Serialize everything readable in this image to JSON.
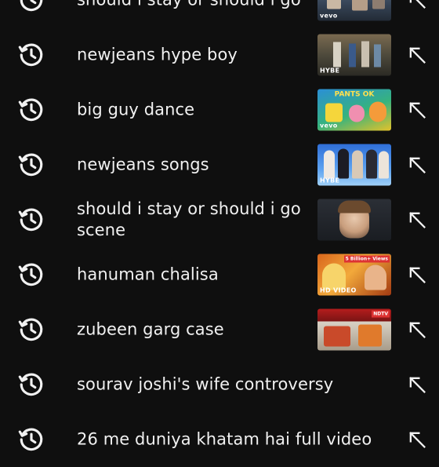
{
  "suggestions": [
    {
      "query": "should i stay or should i go",
      "thumb_brand": "vevo",
      "thumb_banner": "",
      "thumb_badge": ""
    },
    {
      "query": "newjeans hype boy",
      "thumb_brand": "HYBE",
      "thumb_banner": "",
      "thumb_badge": ""
    },
    {
      "query": "big guy dance",
      "thumb_brand": "vevo",
      "thumb_banner": "PANTS OK",
      "thumb_badge": ""
    },
    {
      "query": "newjeans songs",
      "thumb_brand": "HYBE",
      "thumb_banner": "",
      "thumb_badge": ""
    },
    {
      "query": "should i stay or should i go scene",
      "thumb_brand": "",
      "thumb_banner": "",
      "thumb_badge": ""
    },
    {
      "query": "hanuman chalisa",
      "thumb_brand": "HD VIDEO",
      "thumb_banner": "",
      "thumb_badge": "5 Billion+ Views"
    },
    {
      "query": "zubeen garg case",
      "thumb_brand": "",
      "thumb_banner": "",
      "thumb_badge": "NDTV"
    },
    {
      "query": "sourav joshi's wife controversy",
      "thumb_brand": "",
      "thumb_banner": "",
      "thumb_badge": ""
    },
    {
      "query": "26 me duniya khatam hai full video",
      "thumb_brand": "",
      "thumb_banner": "",
      "thumb_badge": ""
    }
  ],
  "icons": {
    "history": "history-icon",
    "fill_query": "arrow-up-left-icon"
  },
  "colors": {
    "background": "#0f0f0f",
    "text": "#f1f1f1"
  }
}
